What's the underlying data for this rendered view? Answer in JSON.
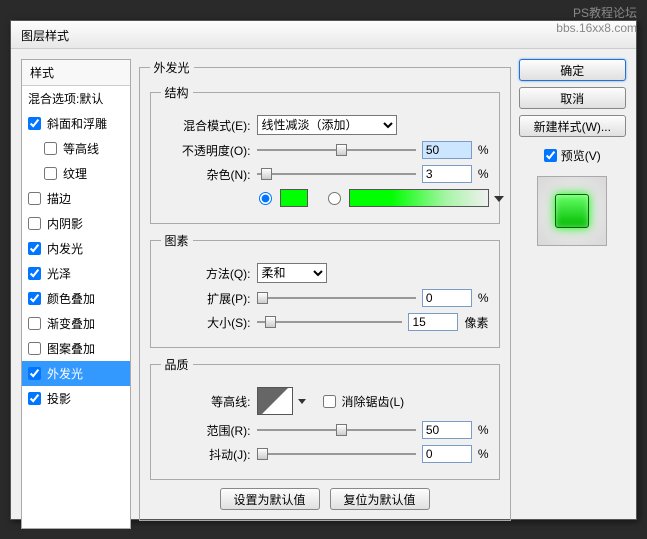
{
  "watermark": {
    "line1": "PS教程论坛",
    "line2": "bbs.16xx8.com"
  },
  "dialog": {
    "title": "图层样式"
  },
  "styles": {
    "header": "样式",
    "blendDefault": "混合选项:默认",
    "items": [
      {
        "label": "斜面和浮雕",
        "checked": true,
        "indent": false
      },
      {
        "label": "等高线",
        "checked": false,
        "indent": true
      },
      {
        "label": "纹理",
        "checked": false,
        "indent": true
      },
      {
        "label": "描边",
        "checked": false,
        "indent": false
      },
      {
        "label": "内阴影",
        "checked": false,
        "indent": false
      },
      {
        "label": "内发光",
        "checked": true,
        "indent": false
      },
      {
        "label": "光泽",
        "checked": true,
        "indent": false
      },
      {
        "label": "颜色叠加",
        "checked": true,
        "indent": false
      },
      {
        "label": "渐变叠加",
        "checked": false,
        "indent": false
      },
      {
        "label": "图案叠加",
        "checked": false,
        "indent": false
      },
      {
        "label": "外发光",
        "checked": true,
        "indent": false,
        "selected": true
      },
      {
        "label": "投影",
        "checked": true,
        "indent": false
      }
    ]
  },
  "outerGlow": {
    "title": "外发光",
    "structure": {
      "legend": "结构",
      "blendModeLabel": "混合模式(E):",
      "blendModeValue": "线性减淡（添加）",
      "opacityLabel": "不透明度(O):",
      "opacityValue": "50",
      "opacityUnit": "%",
      "noiseLabel": "杂色(N):",
      "noiseValue": "3",
      "noiseUnit": "%",
      "colorSelected": true
    },
    "elements": {
      "legend": "图素",
      "techniqueLabel": "方法(Q):",
      "techniqueValue": "柔和",
      "spreadLabel": "扩展(P):",
      "spreadValue": "0",
      "spreadUnit": "%",
      "sizeLabel": "大小(S):",
      "sizeValue": "15",
      "sizeUnit": "像素"
    },
    "quality": {
      "legend": "品质",
      "contourLabel": "等高线:",
      "antiAliasLabel": "消除锯齿(L)",
      "antiAliasChecked": false,
      "rangeLabel": "范围(R):",
      "rangeValue": "50",
      "rangeUnit": "%",
      "jitterLabel": "抖动(J):",
      "jitterValue": "0",
      "jitterUnit": "%"
    },
    "defaults": {
      "setDefault": "设置为默认值",
      "resetDefault": "复位为默认值"
    }
  },
  "rightPanel": {
    "ok": "确定",
    "cancel": "取消",
    "newStyle": "新建样式(W)...",
    "previewLabel": "预览(V)",
    "previewChecked": true
  }
}
